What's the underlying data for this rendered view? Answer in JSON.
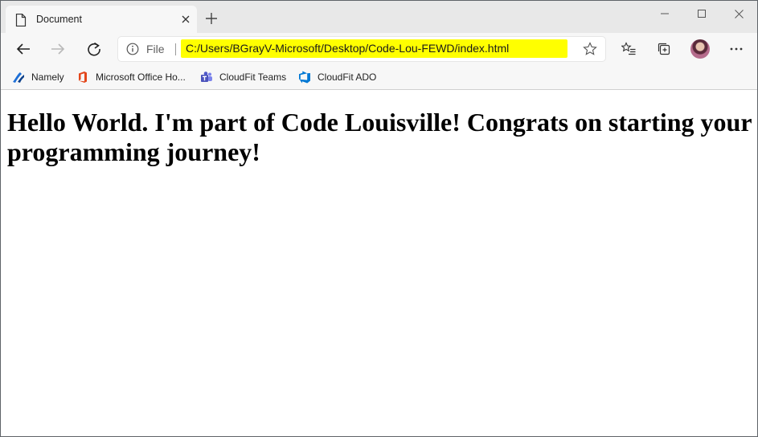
{
  "tab": {
    "title": "Document"
  },
  "address_bar": {
    "scheme_label": "File",
    "url": "C:/Users/BGrayV-Microsoft/Desktop/Code-Lou-FEWD/index.html",
    "highlight_color": "#ffff00"
  },
  "favorites": [
    {
      "label": "Namely",
      "icon": "namely-icon"
    },
    {
      "label": "Microsoft Office Ho...",
      "icon": "office-icon"
    },
    {
      "label": "CloudFit Teams",
      "icon": "teams-icon"
    },
    {
      "label": "CloudFit ADO",
      "icon": "azure-devops-icon"
    }
  ],
  "page": {
    "heading": "Hello World. I'm part of Code Louisville! Congrats on starting your programming journey!"
  }
}
